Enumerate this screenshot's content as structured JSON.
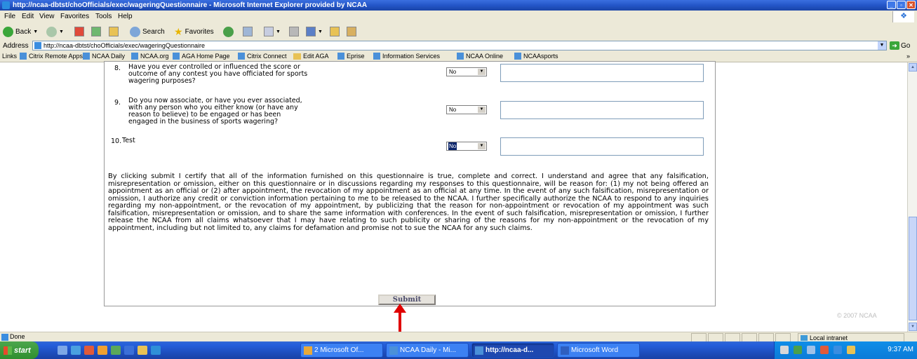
{
  "window": {
    "title": "http://ncaa-dbtst/choOfficials/exec/wageringQuestionnaire - Microsoft Internet Explorer provided by NCAA"
  },
  "menu": [
    "File",
    "Edit",
    "View",
    "Favorites",
    "Tools",
    "Help"
  ],
  "toolbar": {
    "back": "Back",
    "search": "Search",
    "favorites": "Favorites"
  },
  "address": {
    "label": "Address",
    "url": "http://ncaa-dbtst/choOfficials/exec/wageringQuestionnaire",
    "go": "Go"
  },
  "links": {
    "label": "Links",
    "items": [
      "Citrix Remote Apps",
      "NCAA Daily",
      "NCAA.org",
      "AGA Home Page",
      "Citrix Connect",
      "Edit AGA",
      "Eprise",
      "Information Services",
      "NCAA Online",
      "NCAAsports"
    ],
    "more": "»"
  },
  "questions": [
    {
      "number": "8.",
      "text": "Have you ever controlled or influenced the score or\noutcome of any contest you have officiated for sports\nwagering purposes?",
      "answer": "No"
    },
    {
      "number": "9.",
      "text": "Do you now associate, or have you ever associated,\nwith any person who you either know (or have any\nreason to believe) to be engaged or has been\nengaged in the business of sports wagering?",
      "answer": "No"
    },
    {
      "number": "10.",
      "text": "Test",
      "answer": "No"
    }
  ],
  "certification": "By clicking submit I certify that all of the information furnished on this questionnaire is true, complete and correct. I understand and agree that any falsification, misrepresentation or omission, either on this questionnaire or in discussions regarding my responses to this questionnaire, will be reason for: (1) my not being offered an appointment as an official or (2) after appointment, the revocation of my appointment as an official at any time. In the event of any such falsification, misrepresentation or omission, I authorize any credit or conviction information pertaining to me to be released to the NCAA. I further specifically authorize the NCAA to respond to any inquiries regarding my non-appointment, or the revocation of my appointment, by publicizing that the reason for non-appointment or revocation of my appointment was such falsification, misrepresentation or omission, and to share the same information with conferences. In the event of such falsification, misrepresentation or omission, I further release the NCAA from all claims whatsoever that I may have relating to such publicity or sharing of the reasons for my non-appointment or the revocation of my appointment, including but not limited to, any claims for defamation and promise not to sue the NCAA for any such claims.",
  "submit_label": "Submit",
  "copyright": "© 2007 NCAA",
  "status": {
    "text": "Done",
    "zone": "Local intranet"
  },
  "taskbar": {
    "start": "start",
    "tasks": [
      "2 Microsoft Of...",
      "NCAA Daily - Mi...",
      "http://ncaa-d...",
      "Microsoft Word"
    ],
    "clock": "9:37 AM"
  },
  "colors": {
    "title_bar": "#2456c8",
    "taskbar": "#245edb",
    "annotation_arrow": "#e00000"
  }
}
